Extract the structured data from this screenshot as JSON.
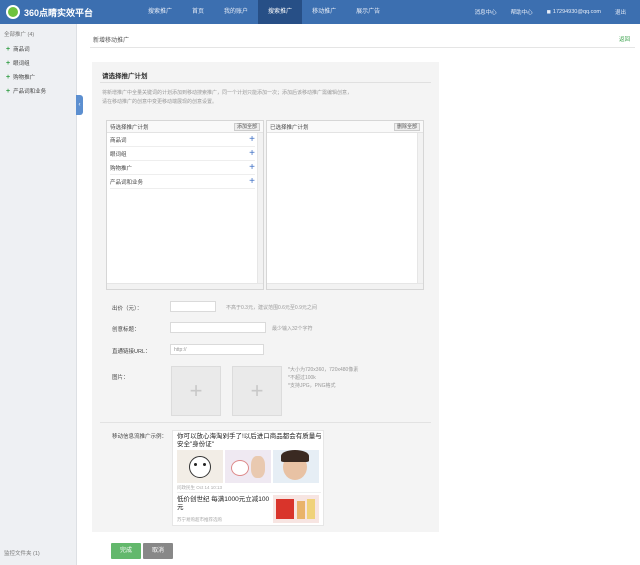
{
  "header": {
    "logo_text": "360点睛实效平台",
    "nav": [
      "搜索推广",
      "首页",
      "我的账户",
      "搜索推广",
      "移动推广",
      "展示广告"
    ],
    "active_index": 3,
    "links": [
      "消息中心",
      "帮助中心"
    ],
    "user": "17294930@qq.com",
    "logout": "退出"
  },
  "sidebar": {
    "title": "全部推广 (4)",
    "items": [
      "商品词",
      "眼词组",
      "购物推广",
      "产品词和业务"
    ],
    "footer": "监控文件夹 (1)"
  },
  "page": {
    "breadcrumb": "新增移动推广",
    "back": "返回",
    "panel_title": "请选择推广计划",
    "intro_line1": "将新增推广中全量关键词的计划添加到移动搜索推广，同一个计划只能添加一次；添加后该移动推广需编辑创意，",
    "intro_line2": "请在移动推广的创意中变更移动端展现的创意设置。"
  },
  "plans": {
    "left_title": "待选择推广计划",
    "add_all": "添加全部",
    "left_items": [
      "商品词",
      "眼词组",
      "购物推广",
      "产品词和业务"
    ],
    "right_title": "已选择推广计划",
    "remove_all": "删除全部"
  },
  "form": {
    "bid_label": "出价（元）：",
    "bid_hint": "不高于0.3元，建议范围0.6元至0.9元之间",
    "creative_label": "创意标题：",
    "creative_hint": "最少输入32个字符",
    "url_label": "直通链接URL：",
    "url_value": "http://",
    "image_label": "图片：",
    "image_hints": [
      "*大小为720x360，720x480像素",
      "*不超过100k",
      "*支持JPG，PNG格式"
    ]
  },
  "sample": {
    "label": "移动信息流推广示例：",
    "title1": "你可以放心海淘剁手了!以后进口商品都会有质量与安全\"身份证\"",
    "meta1": "问政民生  Oct 14 10:13",
    "title2": "低价创世纪 每满1000元立减100元",
    "meta2": "苏宁易购超市推荐选购"
  },
  "buttons": {
    "done": "完成",
    "cancel": "取消"
  },
  "colors": {
    "header": "#3c6fb0",
    "header_active": "#274f86",
    "accent_green": "#63b86c",
    "add_blue": "#3d6fc4"
  }
}
